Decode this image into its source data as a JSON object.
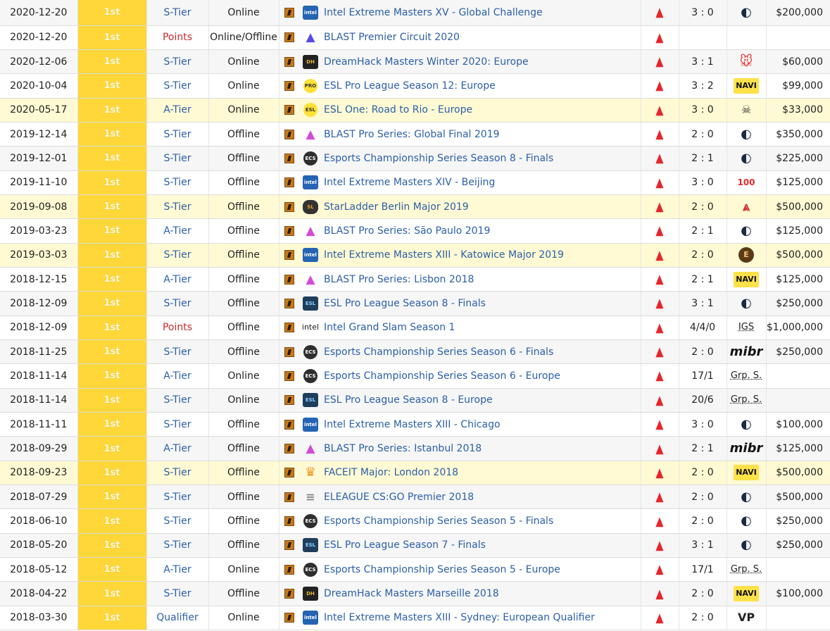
{
  "rows": [
    {
      "date": "2020-12-20",
      "place": "1st",
      "tier": "S-Tier",
      "tier_red": false,
      "type": "Online",
      "tlogo": "intel-logo",
      "tlogo_text": "intel",
      "tournament": "Intel Extreme Masters XV - Global Challenge",
      "score": "3 : 0",
      "opponent": "liquid",
      "prize": "$200,000",
      "major": false
    },
    {
      "date": "2020-12-20",
      "place": "1st",
      "tier": "Points",
      "tier_red": true,
      "type": "Online/Offline",
      "tlogo": "blast-logo",
      "tlogo_text": "▲",
      "tournament": "BLAST Premier Circuit 2020",
      "score": "",
      "opponent": "",
      "prize": "",
      "major": false
    },
    {
      "date": "2020-12-06",
      "place": "1st",
      "tier": "S-Tier",
      "tier_red": false,
      "type": "Online",
      "tlogo": "dreamhack-logo",
      "tlogo_text": "DH",
      "tournament": "DreamHack Masters Winter 2020: Europe",
      "score": "3 : 1",
      "opponent": "mousesports",
      "prize": "$60,000",
      "major": false
    },
    {
      "date": "2020-10-04",
      "place": "1st",
      "tier": "S-Tier",
      "tier_red": false,
      "type": "Online",
      "tlogo": "esl-pro-league-logo",
      "tlogo_text": "PRO",
      "tournament": "ESL Pro League Season 12: Europe",
      "score": "3 : 2",
      "opponent": "navi",
      "prize": "$99,000",
      "major": false
    },
    {
      "date": "2020-05-17",
      "place": "1st",
      "tier": "A-Tier",
      "tier_red": false,
      "type": "Online",
      "tlogo": "esl-one-logo",
      "tlogo_text": "ESL",
      "tournament": "ESL One: Road to Rio - Europe",
      "score": "3 : 0",
      "opponent": "g2",
      "prize": "$33,000",
      "major": true
    },
    {
      "date": "2019-12-14",
      "place": "1st",
      "tier": "S-Tier",
      "tier_red": false,
      "type": "Offline",
      "tlogo": "blast-pro-logo",
      "tlogo_text": "▲",
      "tournament": "BLAST Pro Series: Global Final 2019",
      "score": "2 : 0",
      "opponent": "liquid",
      "prize": "$350,000",
      "major": false
    },
    {
      "date": "2019-12-01",
      "place": "1st",
      "tier": "S-Tier",
      "tier_red": false,
      "type": "Offline",
      "tlogo": "ecs-logo",
      "tlogo_text": "ECS",
      "tournament": "Esports Championship Series Season 8 - Finals",
      "score": "2 : 1",
      "opponent": "liquid",
      "prize": "$225,000",
      "major": false
    },
    {
      "date": "2019-11-10",
      "place": "1st",
      "tier": "S-Tier",
      "tier_red": false,
      "type": "Offline",
      "tlogo": "intel-logo",
      "tlogo_text": "intel",
      "tournament": "Intel Extreme Masters XIV - Beijing",
      "score": "3 : 0",
      "opponent": "100thieves",
      "prize": "$125,000",
      "major": false
    },
    {
      "date": "2019-09-08",
      "place": "1st",
      "tier": "S-Tier",
      "tier_red": false,
      "type": "Offline",
      "tlogo": "starladder-logo",
      "tlogo_text": "SL",
      "tournament": "StarLadder Berlin Major 2019",
      "score": "2 : 0",
      "opponent": "avangar",
      "prize": "$500,000",
      "major": true
    },
    {
      "date": "2019-03-23",
      "place": "1st",
      "tier": "A-Tier",
      "tier_red": false,
      "type": "Offline",
      "tlogo": "blast-pro-logo",
      "tlogo_text": "▲",
      "tournament": "BLAST Pro Series: São Paulo 2019",
      "score": "2 : 1",
      "opponent": "liquid",
      "prize": "$125,000",
      "major": false
    },
    {
      "date": "2019-03-03",
      "place": "1st",
      "tier": "S-Tier",
      "tier_red": false,
      "type": "Offline",
      "tlogo": "intel-logo",
      "tlogo_text": "intel",
      "tournament": "Intel Extreme Masters XIII - Katowice Major 2019",
      "score": "2 : 0",
      "opponent": "ence",
      "prize": "$500,000",
      "major": true
    },
    {
      "date": "2018-12-15",
      "place": "1st",
      "tier": "A-Tier",
      "tier_red": false,
      "type": "Offline",
      "tlogo": "blast-pro-logo",
      "tlogo_text": "▲",
      "tournament": "BLAST Pro Series: Lisbon 2018",
      "score": "2 : 1",
      "opponent": "navi",
      "prize": "$125,000",
      "major": false
    },
    {
      "date": "2018-12-09",
      "place": "1st",
      "tier": "S-Tier",
      "tier_red": false,
      "type": "Offline",
      "tlogo": "esl-season-logo",
      "tlogo_text": "ESL",
      "tournament": "ESL Pro League Season 8 - Finals",
      "score": "3 : 1",
      "opponent": "liquid",
      "prize": "$250,000",
      "major": false
    },
    {
      "date": "2018-12-09",
      "place": "1st",
      "tier": "Points",
      "tier_red": true,
      "type": "Offline",
      "tlogo": "intel-word-logo",
      "tlogo_text": "intel",
      "tournament": "Intel Grand Slam Season 1",
      "score": "4/4/0",
      "opponent": "IGS",
      "prize": "$1,000,000",
      "major": false
    },
    {
      "date": "2018-11-25",
      "place": "1st",
      "tier": "S-Tier",
      "tier_red": false,
      "type": "Offline",
      "tlogo": "ecs-logo",
      "tlogo_text": "ECS",
      "tournament": "Esports Championship Series Season 6 - Finals",
      "score": "2 : 0",
      "opponent": "mibr",
      "prize": "$250,000",
      "major": false
    },
    {
      "date": "2018-11-14",
      "place": "1st",
      "tier": "A-Tier",
      "tier_red": false,
      "type": "Online",
      "tlogo": "ecs-logo",
      "tlogo_text": "ECS",
      "tournament": "Esports Championship Series Season 6 - Europe",
      "score": "17/1",
      "opponent": "Grp. S.",
      "prize": "",
      "major": false
    },
    {
      "date": "2018-11-14",
      "place": "1st",
      "tier": "S-Tier",
      "tier_red": false,
      "type": "Online",
      "tlogo": "esl-season-logo",
      "tlogo_text": "ESL",
      "tournament": "ESL Pro League Season 8 - Europe",
      "score": "20/6",
      "opponent": "Grp. S.",
      "prize": "",
      "major": false
    },
    {
      "date": "2018-11-11",
      "place": "1st",
      "tier": "S-Tier",
      "tier_red": false,
      "type": "Offline",
      "tlogo": "intel-logo",
      "tlogo_text": "intel",
      "tournament": "Intel Extreme Masters XIII - Chicago",
      "score": "3 : 0",
      "opponent": "liquid",
      "prize": "$100,000",
      "major": false
    },
    {
      "date": "2018-09-29",
      "place": "1st",
      "tier": "A-Tier",
      "tier_red": false,
      "type": "Offline",
      "tlogo": "blast-pro-logo",
      "tlogo_text": "▲",
      "tournament": "BLAST Pro Series: Istanbul 2018",
      "score": "2 : 1",
      "opponent": "mibr",
      "prize": "$125,000",
      "major": false
    },
    {
      "date": "2018-09-23",
      "place": "1st",
      "tier": "S-Tier",
      "tier_red": false,
      "type": "Offline",
      "tlogo": "faceit-logo",
      "tlogo_text": "♛",
      "tournament": "FACEIT Major: London 2018",
      "score": "2 : 0",
      "opponent": "navi",
      "prize": "$500,000",
      "major": true
    },
    {
      "date": "2018-07-29",
      "place": "1st",
      "tier": "S-Tier",
      "tier_red": false,
      "type": "Offline",
      "tlogo": "eleague-logo",
      "tlogo_text": "≡",
      "tournament": "ELEAGUE CS:GO Premier 2018",
      "score": "2 : 0",
      "opponent": "liquid",
      "prize": "$500,000",
      "major": false
    },
    {
      "date": "2018-06-10",
      "place": "1st",
      "tier": "S-Tier",
      "tier_red": false,
      "type": "Offline",
      "tlogo": "ecs-logo",
      "tlogo_text": "ECS",
      "tournament": "Esports Championship Series Season 5 - Finals",
      "score": "2 : 0",
      "opponent": "liquid",
      "prize": "$250,000",
      "major": false
    },
    {
      "date": "2018-05-20",
      "place": "1st",
      "tier": "S-Tier",
      "tier_red": false,
      "type": "Offline",
      "tlogo": "esl-season-logo",
      "tlogo_text": "ESL",
      "tournament": "ESL Pro League Season 7 - Finals",
      "score": "3 : 1",
      "opponent": "liquid",
      "prize": "$250,000",
      "major": false
    },
    {
      "date": "2018-05-12",
      "place": "1st",
      "tier": "A-Tier",
      "tier_red": false,
      "type": "Online",
      "tlogo": "ecs-logo",
      "tlogo_text": "ECS",
      "tournament": "Esports Championship Series Season 5 - Europe",
      "score": "17/1",
      "opponent": "Grp. S.",
      "prize": "",
      "major": false
    },
    {
      "date": "2018-04-22",
      "place": "1st",
      "tier": "S-Tier",
      "tier_red": false,
      "type": "Offline",
      "tlogo": "dreamhack-logo",
      "tlogo_text": "DH",
      "tournament": "DreamHack Masters Marseille 2018",
      "score": "2 : 0",
      "opponent": "navi",
      "prize": "$100,000",
      "major": false
    },
    {
      "date": "2018-03-30",
      "place": "1st",
      "tier": "Qualifier",
      "tier_red": false,
      "type": "Online",
      "tlogo": "intel-logo",
      "tlogo_text": "intel",
      "tournament": "Intel Extreme Masters XIII - Sydney: European Qualifier",
      "score": "2 : 0",
      "opponent": "virtuspro",
      "prize": "",
      "major": false
    }
  ],
  "colors": {
    "place_bg": "#ffd739",
    "link": "#2b5fa8",
    "points": "#d12b2b",
    "major_row": "#fffad3",
    "astralis": "#e8242b"
  }
}
